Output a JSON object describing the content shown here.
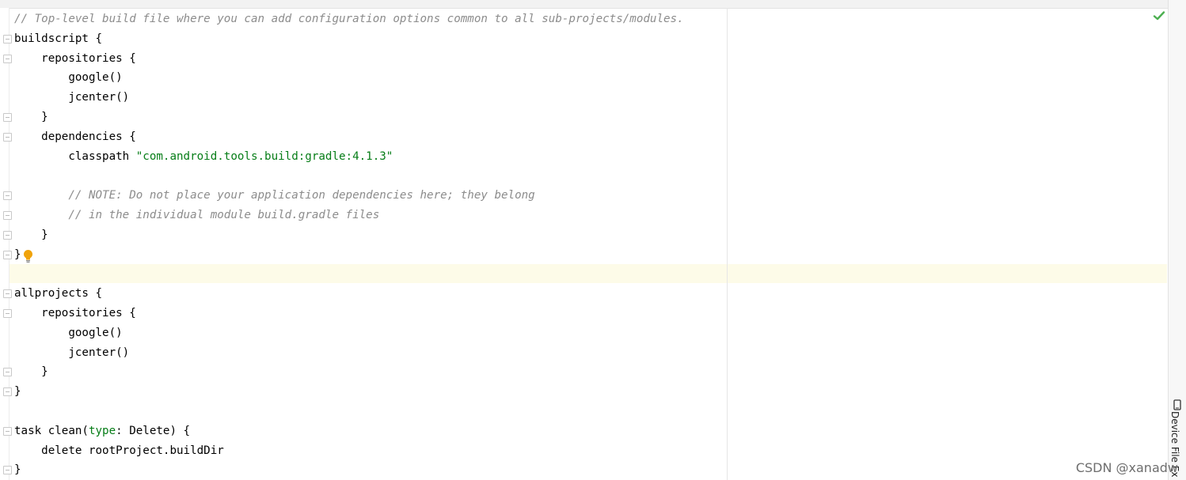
{
  "editor": {
    "lines": [
      {
        "segments": [
          {
            "t": "// Top-level build file where you can add configuration options common to all sub-projects/modules.",
            "c": "cm"
          }
        ]
      },
      {
        "segments": [
          {
            "t": "buildscript ",
            "c": "nm"
          },
          {
            "t": "{",
            "c": "nm"
          }
        ]
      },
      {
        "segments": [
          {
            "t": "    repositories ",
            "c": "nm"
          },
          {
            "t": "{",
            "c": "nm"
          }
        ]
      },
      {
        "segments": [
          {
            "t": "        google()",
            "c": "nm"
          }
        ]
      },
      {
        "segments": [
          {
            "t": "        jcenter()",
            "c": "nm"
          }
        ]
      },
      {
        "segments": [
          {
            "t": "    }",
            "c": "nm"
          }
        ]
      },
      {
        "segments": [
          {
            "t": "    dependencies ",
            "c": "nm"
          },
          {
            "t": "{",
            "c": "nm"
          }
        ]
      },
      {
        "segments": [
          {
            "t": "        classpath ",
            "c": "nm"
          },
          {
            "t": "\"com.android.tools.build:gradle:4.1.3\"",
            "c": "str"
          }
        ]
      },
      {
        "segments": [
          {
            "t": "",
            "c": "nm"
          }
        ]
      },
      {
        "segments": [
          {
            "t": "        // NOTE: Do not place your application dependencies here; they belong",
            "c": "cm"
          }
        ]
      },
      {
        "segments": [
          {
            "t": "        // in the individual module build.gradle files",
            "c": "cm"
          }
        ]
      },
      {
        "segments": [
          {
            "t": "    }",
            "c": "nm"
          }
        ]
      },
      {
        "segments": [
          {
            "t": "}",
            "c": "nm"
          }
        ]
      },
      {
        "segments": [
          {
            "t": "",
            "c": "nm"
          }
        ]
      },
      {
        "segments": [
          {
            "t": "allprojects ",
            "c": "nm"
          },
          {
            "t": "{",
            "c": "nm"
          }
        ]
      },
      {
        "segments": [
          {
            "t": "    repositories ",
            "c": "nm"
          },
          {
            "t": "{",
            "c": "nm"
          }
        ]
      },
      {
        "segments": [
          {
            "t": "        google()",
            "c": "nm"
          }
        ]
      },
      {
        "segments": [
          {
            "t": "        jcenter()",
            "c": "nm"
          }
        ]
      },
      {
        "segments": [
          {
            "t": "    }",
            "c": "nm"
          }
        ]
      },
      {
        "segments": [
          {
            "t": "}",
            "c": "nm"
          }
        ]
      },
      {
        "segments": [
          {
            "t": "",
            "c": "nm"
          }
        ]
      },
      {
        "segments": [
          {
            "t": "task clean(",
            "c": "nm"
          },
          {
            "t": "type",
            "c": "named"
          },
          {
            "t": ": Delete) {",
            "c": "nm"
          }
        ]
      },
      {
        "segments": [
          {
            "t": "    delete rootProject.buildDir",
            "c": "nm"
          }
        ]
      },
      {
        "segments": [
          {
            "t": "}",
            "c": "nm"
          }
        ]
      }
    ]
  },
  "side_panel": {
    "tab_label": "Device File Ex"
  },
  "watermark": "CSDN @xanadw",
  "colors": {
    "comment": "#8c8c8c",
    "string": "#067d17",
    "caret_line": "#fdfbe8",
    "check": "#4caf50",
    "bulb": "#f0a30a"
  },
  "icons": [
    "check-icon",
    "lightbulb-icon",
    "fold-marker-icon",
    "device-icon"
  ]
}
